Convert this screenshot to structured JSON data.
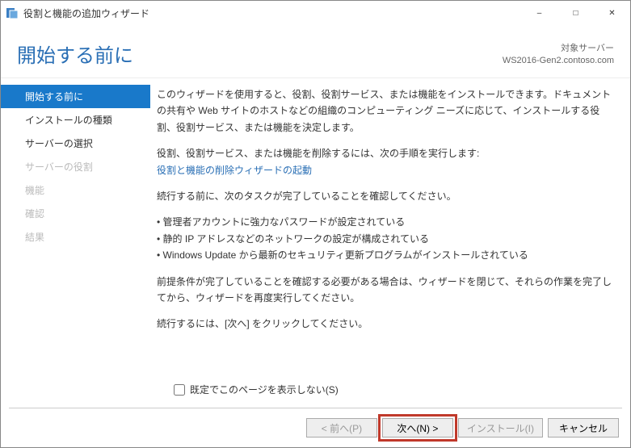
{
  "window": {
    "title": "役割と機能の追加ウィザード"
  },
  "header": {
    "page_title": "開始する前に",
    "target_label": "対象サーバー",
    "target_server": "WS2016-Gen2.contoso.com"
  },
  "sidebar": {
    "items": [
      {
        "label": "開始する前に",
        "state": "active"
      },
      {
        "label": "インストールの種類",
        "state": "normal"
      },
      {
        "label": "サーバーの選択",
        "state": "normal"
      },
      {
        "label": "サーバーの役割",
        "state": "disabled"
      },
      {
        "label": "機能",
        "state": "disabled"
      },
      {
        "label": "確認",
        "state": "disabled"
      },
      {
        "label": "結果",
        "state": "disabled"
      }
    ]
  },
  "content": {
    "intro": "このウィザードを使用すると、役割、役割サービス、または機能をインストールできます。ドキュメントの共有や Web サイトのホストなどの組織のコンピューティング ニーズに応じて、インストールする役割、役割サービス、または機能を決定します。",
    "remove_lead": "役割、役割サービス、または機能を削除するには、次の手順を実行します:",
    "remove_link": "役割と機能の削除ウィザードの起動",
    "tasks_lead": "続行する前に、次のタスクが完了していることを確認してください。",
    "tasks": [
      "管理者アカウントに強力なパスワードが設定されている",
      "静的 IP アドレスなどのネットワークの設定が構成されている",
      "Windows Update から最新のセキュリティ更新プログラムがインストールされている"
    ],
    "prereq": "前提条件が完了していることを確認する必要がある場合は、ウィザードを閉じて、それらの作業を完了してから、ウィザードを再度実行してください。",
    "continue_hint": "続行するには、[次へ] をクリックしてください。"
  },
  "skip": {
    "label": "既定でこのページを表示しない(S)"
  },
  "footer": {
    "prev": "< 前へ(P)",
    "next": "次へ(N) >",
    "install": "インストール(I)",
    "cancel": "キャンセル"
  }
}
